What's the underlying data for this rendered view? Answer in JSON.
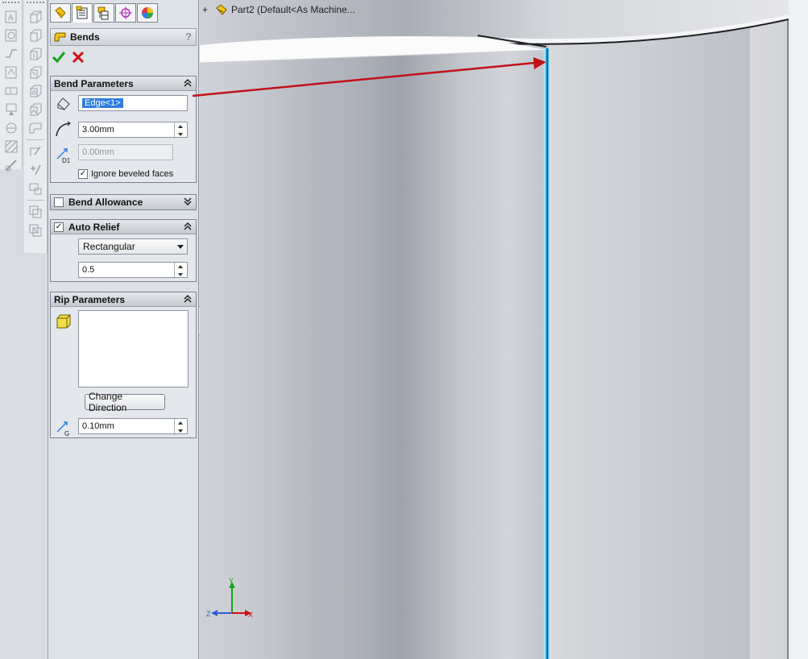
{
  "tabs": [
    {
      "name": "featuremanager-tab-icon"
    },
    {
      "name": "propertymanager-tab-icon"
    },
    {
      "name": "configurationmanager-tab-icon"
    },
    {
      "name": "dimxpert-tab-icon"
    },
    {
      "name": "display-manager-tab-icon"
    }
  ],
  "panel": {
    "title": "Bends",
    "help": "?"
  },
  "bend_parameters": {
    "header": "Bend Parameters",
    "edge_selection": "Edge<1>",
    "bend_radius": "3.00mm",
    "d1_value": "0.00mm",
    "ignore_beveled_label": "Ignore beveled faces",
    "ignore_beveled_checked": "✓"
  },
  "bend_allowance": {
    "header": "Bend Allowance",
    "checked": ""
  },
  "auto_relief": {
    "header": "Auto Relief",
    "checked": "✓",
    "type": "Rectangular",
    "ratio": "0.5"
  },
  "rip_parameters": {
    "header": "Rip Parameters",
    "change_direction_label": "Change Direction",
    "gap": "0.10mm"
  },
  "tree": {
    "expander": "+",
    "label": "Part2  (Default<As Machine..."
  },
  "triad": {
    "x": "X",
    "y": "Y",
    "z": "Z"
  },
  "colors": {
    "accept": "#1a9e1a",
    "cancel": "#d01010",
    "selection": "#2f7ee0",
    "callout_arrow": "#c0111a",
    "edge_highlight": "#4fc6f2"
  }
}
